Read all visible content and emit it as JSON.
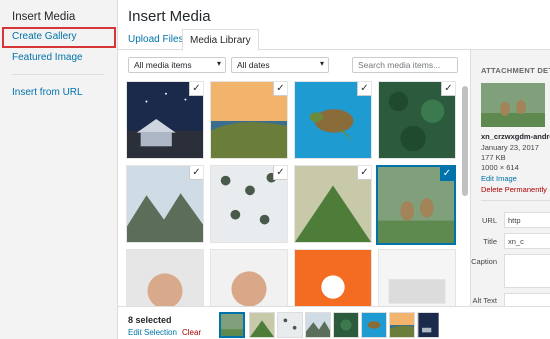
{
  "menu": {
    "heading": "Insert Media",
    "create_gallery": "Create Gallery",
    "featured_image": "Featured Image",
    "insert_from_url": "Insert from URL"
  },
  "header": {
    "title": "Insert Media"
  },
  "tabs": {
    "upload": "Upload Files",
    "library": "Media Library"
  },
  "toolbar": {
    "type_filter": "All media items",
    "date_filter": "All dates",
    "search_placeholder": "Search media items..."
  },
  "grid": {
    "check_glyph": "✓",
    "items": [
      {
        "icon": "house-night-image"
      },
      {
        "icon": "coastal-cliffs-image"
      },
      {
        "icon": "sea-turtle-image"
      },
      {
        "icon": "forest-aerial-image"
      },
      {
        "icon": "rocky-mountains-image"
      },
      {
        "icon": "snowy-forest-image"
      },
      {
        "icon": "green-ridge-image"
      },
      {
        "icon": "deer-forest-image"
      },
      {
        "icon": "man-portrait-image"
      },
      {
        "icon": "smiling-man-image"
      },
      {
        "icon": "avatar-placeholder-image"
      },
      {
        "icon": "keyboard-image"
      }
    ]
  },
  "details": {
    "heading": "ATTACHMENT DETA",
    "filename": "xn_crzwxgdm-andre",
    "date": "January 23, 2017",
    "size": "177 KB",
    "dimensions": "1000 × 614",
    "edit_image": "Edit Image",
    "delete": "Delete Permanently",
    "url_label": "URL",
    "url_value": "http",
    "title_label": "Title",
    "title_value": "xn_c",
    "caption_label": "Caption",
    "alt_label": "Alt Text"
  },
  "bottom": {
    "selected": "8 selected",
    "edit_selection": "Edit Selection",
    "clear": "Clear"
  },
  "colors": {
    "accent": "#0073aa",
    "highlight_box": "#d63638",
    "delete": "#a00"
  }
}
